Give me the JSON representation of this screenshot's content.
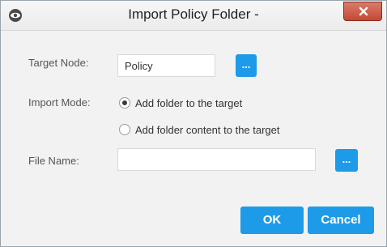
{
  "window": {
    "title": "Import Policy Folder -",
    "icon": "eye-icon",
    "close_icon": "close-icon",
    "accent_color": "#1e9be8",
    "close_color": "#c24a34"
  },
  "form": {
    "target_node": {
      "label": "Target Node:",
      "value": "Policy",
      "browse_label": "..."
    },
    "import_mode": {
      "label": "Import Mode:",
      "options": [
        {
          "label": "Add folder to the target",
          "checked": true
        },
        {
          "label": "Add folder content to the target",
          "checked": false
        }
      ]
    },
    "file_name": {
      "label": "File Name:",
      "value": "",
      "browse_label": "..."
    }
  },
  "buttons": {
    "ok": "OK",
    "cancel": "Cancel"
  }
}
